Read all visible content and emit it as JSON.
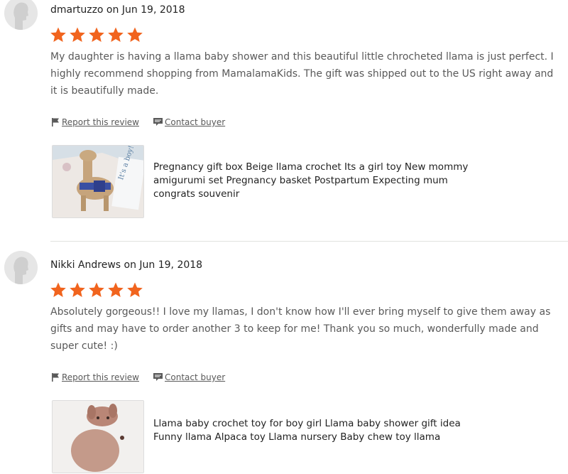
{
  "reviews": [
    {
      "author": "dmartuzzo",
      "date": "Jun 19, 2018",
      "byline": "dmartuzzo on Jun 19, 2018",
      "rating": 5,
      "text": "My daughter is having a llama baby shower and this beautiful little chrocheted llama is just perfect. I highly recommend shopping from MamalamaKids. The gift was shipped out to the US right away and it is beautifully made.",
      "report_label": "Report this review",
      "contact_label": "Contact buyer",
      "product_title": "Pregnancy gift box Beige llama crochet Its a girl toy New mommy amigurumi set Pregnancy basket Postpartum Expecting mum congrats souvenir",
      "thumb_card_text": "It's a boy!"
    },
    {
      "author": "Nikki Andrews",
      "date": "Jun 19, 2018",
      "byline": "Nikki Andrews on Jun 19, 2018",
      "rating": 5,
      "text": "Absolutely gorgeous!! I love my llamas, I don't know how I'll ever bring myself to give them away as gifts and may have to order another 3 to keep for me! Thank you so much, wonderfully made and super cute! :)",
      "report_label": "Report this review",
      "contact_label": "Contact buyer",
      "product_title": "Llama baby crochet toy for boy girl Llama baby shower gift idea Funny llama Alpaca toy Llama nursery Baby chew toy llama"
    }
  ],
  "colors": {
    "star": "#F1641E",
    "link": "#595959",
    "divider": "#e1e3df"
  },
  "icons": {
    "avatar": "default-user-avatar-icon",
    "star": "star-icon",
    "report": "flag-icon",
    "contact": "chat-bubble-icon"
  }
}
